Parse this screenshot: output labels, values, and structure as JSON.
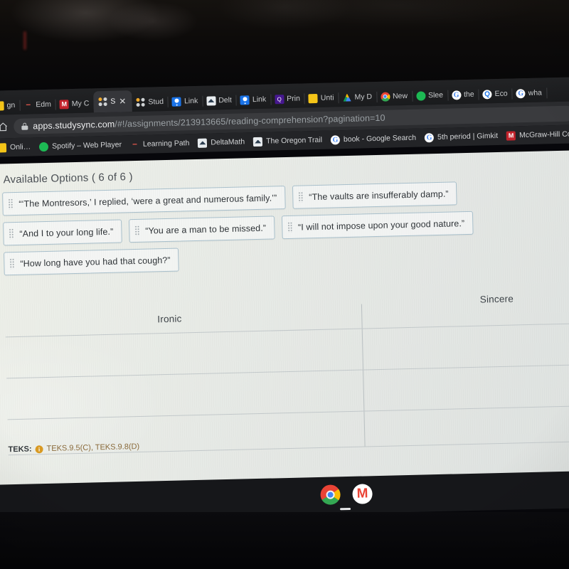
{
  "browser": {
    "tabs": [
      {
        "label": "gn",
        "icon": "generic-favicon",
        "active": false
      },
      {
        "label": "Edm",
        "icon": "edmentum-favicon",
        "active": false
      },
      {
        "label": "My C",
        "icon": "mcgraw-hill-favicon",
        "active": false
      },
      {
        "label": "S",
        "icon": "studysync-favicon",
        "active": true
      },
      {
        "label": "Stud",
        "icon": "studysync-favicon",
        "active": false
      },
      {
        "label": "Link",
        "icon": "google-classroom-favicon",
        "active": false
      },
      {
        "label": "Delt",
        "icon": "deltamath-favicon",
        "active": false
      },
      {
        "label": "Link",
        "icon": "google-classroom-favicon",
        "active": false
      },
      {
        "label": "Prin",
        "icon": "quizizz-favicon",
        "active": false
      },
      {
        "label": "Unti",
        "icon": "google-docs-favicon",
        "active": false
      },
      {
        "label": "My D",
        "icon": "google-drive-favicon",
        "active": false
      },
      {
        "label": "New",
        "icon": "chrome-favicon",
        "active": false
      },
      {
        "label": "Slee",
        "icon": "spotify-favicon",
        "active": false
      },
      {
        "label": "the",
        "icon": "google-favicon",
        "active": false
      },
      {
        "label": "Eco",
        "icon": "search-favicon",
        "active": false
      },
      {
        "label": "wha",
        "icon": "google-favicon",
        "active": false
      }
    ],
    "close_tab_label": "✕",
    "omnibox": {
      "host": "apps.studysync.com",
      "path": "/#!/assignments/213913665/reading-comprehension?pagination=10",
      "lock_icon": "lock-icon",
      "home_icon": "home-icon"
    },
    "bookmarks": [
      {
        "label": "Onli…",
        "icon": "generic-favicon"
      },
      {
        "label": "Spotify – Web Player",
        "icon": "spotify-favicon"
      },
      {
        "label": "Learning Path",
        "icon": "edmentum-favicon"
      },
      {
        "label": "DeltaMath",
        "icon": "deltamath-favicon"
      },
      {
        "label": "The Oregon Trail",
        "icon": "oregon-trail-favicon"
      },
      {
        "label": "book - Google Search",
        "icon": "google-favicon"
      },
      {
        "label": "5th period | Gimkit",
        "icon": "gimkit-favicon"
      },
      {
        "label": "McGraw-Hill Conne",
        "icon": "mcgraw-hill-favicon"
      }
    ]
  },
  "content": {
    "available_options_title": "Available Options ( 6 of 6 )",
    "options": [
      "“‘The Montresors,’ I replied, ‘were a great and numerous family.’”",
      "“The vaults are insufferably damp.”",
      "“And I to your long life.”",
      "“You are a man to be missed.”",
      "“I will not impose upon your good nature.”",
      "“How long have you had that cough?”"
    ],
    "table": {
      "columns": [
        "Ironic",
        "Sincere"
      ],
      "rows": [
        [
          "",
          ""
        ],
        [
          "",
          ""
        ],
        [
          "",
          ""
        ]
      ]
    },
    "teks": {
      "label": "TEKS:",
      "info_icon": "info-icon",
      "codes": "TEKS.9.5(C), TEKS.9.8(D)"
    }
  },
  "shelf": {
    "apps": [
      {
        "name": "chrome-app-icon"
      },
      {
        "name": "gmail-app-icon"
      }
    ]
  },
  "colors": {
    "chip_border": "#a9c0cc",
    "page_bg": "#e9ece7",
    "chrome_dark": "#2b2c2f",
    "teks_accent": "#8a6a3a",
    "info_badge": "#d99a23"
  }
}
